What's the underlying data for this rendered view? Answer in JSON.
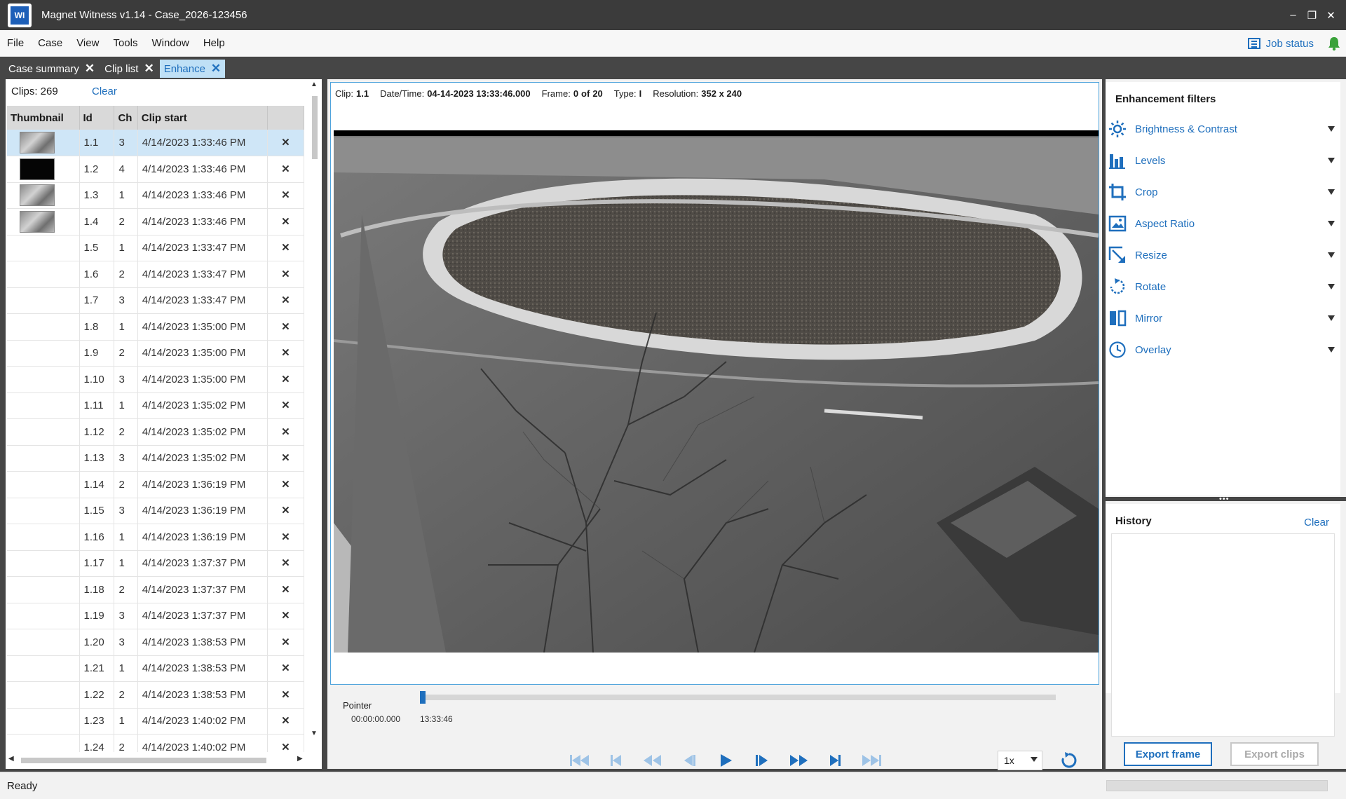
{
  "window": {
    "title": "Magnet Witness v1.14 - Case_2026-123456",
    "logo_text": "WI"
  },
  "menu": [
    "File",
    "Case",
    "View",
    "Tools",
    "Window",
    "Help"
  ],
  "job_status": "Job status",
  "tabs": [
    {
      "label": "Case summary",
      "active": false
    },
    {
      "label": "Clip list",
      "active": false
    },
    {
      "label": "Enhance",
      "active": true
    }
  ],
  "clips": {
    "count_label": "Clips: 269",
    "clear": "Clear",
    "columns": [
      "Thumbnail",
      "Id",
      "Ch",
      "Clip start"
    ],
    "rows": [
      {
        "thumb": "gray",
        "id": "1.1",
        "ch": "3",
        "start": "4/14/2023 1:33:46 PM"
      },
      {
        "thumb": "black",
        "id": "1.2",
        "ch": "4",
        "start": "4/14/2023 1:33:46 PM"
      },
      {
        "thumb": "gray",
        "id": "1.3",
        "ch": "1",
        "start": "4/14/2023 1:33:46 PM"
      },
      {
        "thumb": "gray",
        "id": "1.4",
        "ch": "2",
        "start": "4/14/2023 1:33:46 PM"
      },
      {
        "thumb": "",
        "id": "1.5",
        "ch": "1",
        "start": "4/14/2023 1:33:47 PM"
      },
      {
        "thumb": "",
        "id": "1.6",
        "ch": "2",
        "start": "4/14/2023 1:33:47 PM"
      },
      {
        "thumb": "",
        "id": "1.7",
        "ch": "3",
        "start": "4/14/2023 1:33:47 PM"
      },
      {
        "thumb": "",
        "id": "1.8",
        "ch": "1",
        "start": "4/14/2023 1:35:00 PM"
      },
      {
        "thumb": "",
        "id": "1.9",
        "ch": "2",
        "start": "4/14/2023 1:35:00 PM"
      },
      {
        "thumb": "",
        "id": "1.10",
        "ch": "3",
        "start": "4/14/2023 1:35:00 PM"
      },
      {
        "thumb": "",
        "id": "1.11",
        "ch": "1",
        "start": "4/14/2023 1:35:02 PM"
      },
      {
        "thumb": "",
        "id": "1.12",
        "ch": "2",
        "start": "4/14/2023 1:35:02 PM"
      },
      {
        "thumb": "",
        "id": "1.13",
        "ch": "3",
        "start": "4/14/2023 1:35:02 PM"
      },
      {
        "thumb": "",
        "id": "1.14",
        "ch": "2",
        "start": "4/14/2023 1:36:19 PM"
      },
      {
        "thumb": "",
        "id": "1.15",
        "ch": "3",
        "start": "4/14/2023 1:36:19 PM"
      },
      {
        "thumb": "",
        "id": "1.16",
        "ch": "1",
        "start": "4/14/2023 1:36:19 PM"
      },
      {
        "thumb": "",
        "id": "1.17",
        "ch": "1",
        "start": "4/14/2023 1:37:37 PM"
      },
      {
        "thumb": "",
        "id": "1.18",
        "ch": "2",
        "start": "4/14/2023 1:37:37 PM"
      },
      {
        "thumb": "",
        "id": "1.19",
        "ch": "3",
        "start": "4/14/2023 1:37:37 PM"
      },
      {
        "thumb": "",
        "id": "1.20",
        "ch": "3",
        "start": "4/14/2023 1:38:53 PM"
      },
      {
        "thumb": "",
        "id": "1.21",
        "ch": "1",
        "start": "4/14/2023 1:38:53 PM"
      },
      {
        "thumb": "",
        "id": "1.22",
        "ch": "2",
        "start": "4/14/2023 1:38:53 PM"
      },
      {
        "thumb": "",
        "id": "1.23",
        "ch": "1",
        "start": "4/14/2023 1:40:02 PM"
      },
      {
        "thumb": "",
        "id": "1.24",
        "ch": "2",
        "start": "4/14/2023 1:40:02 PM"
      }
    ],
    "selected_id": "1.1"
  },
  "viewer": {
    "clip_label": "Clip:",
    "clip": "1.1",
    "datetime_label": "Date/Time:",
    "datetime": "04-14-2023 13:33:46.000",
    "frame_label": "Frame:",
    "frame": "0",
    "of_label": "of",
    "frame_total": "20",
    "type_label": "Type:",
    "type": "I",
    "resolution_label": "Resolution:",
    "resolution": "352 x 240"
  },
  "timeline": {
    "pointer_label": "Pointer",
    "pointer_time": "00:00:00.000",
    "tick_time": "13:33:46",
    "speed": "1x"
  },
  "filters": {
    "title": "Enhancement filters",
    "items": [
      {
        "label": "Brightness & Contrast",
        "icon": "sun-icon"
      },
      {
        "label": "Levels",
        "icon": "levels-icon"
      },
      {
        "label": "Crop",
        "icon": "crop-icon"
      },
      {
        "label": "Aspect Ratio",
        "icon": "aspect-ratio-icon"
      },
      {
        "label": "Resize",
        "icon": "resize-icon"
      },
      {
        "label": "Rotate",
        "icon": "rotate-icon"
      },
      {
        "label": "Mirror",
        "icon": "mirror-icon"
      },
      {
        "label": "Overlay",
        "icon": "clock-icon"
      }
    ]
  },
  "history": {
    "title": "History",
    "clear": "Clear"
  },
  "actions": {
    "export_frame": "Export frame",
    "export_clips": "Export clips"
  },
  "status": {
    "text": "Ready"
  },
  "colors": {
    "accent": "#1f6fbd",
    "delete": "#e24a1e",
    "selection": "#cfe6f7",
    "chrome": "#464646"
  }
}
